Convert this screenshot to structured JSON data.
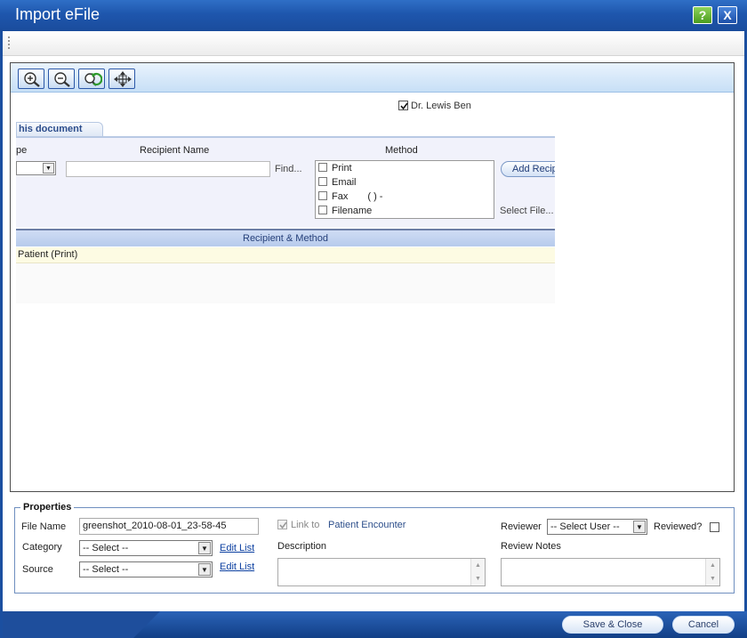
{
  "window": {
    "title": "Import eFile",
    "help_label": "?",
    "close_label": "X"
  },
  "viewer": {
    "tools": [
      "zoom-in-icon",
      "zoom-out-icon",
      "rotate-icon",
      "fit-icon"
    ],
    "doc": {
      "top_check_label": "Dr. Lewis Ben",
      "tab_label": "his document",
      "col_type": "pe",
      "col_recipient": "Recipient Name",
      "col_method": "Method",
      "find_label": "Find...",
      "methods": [
        "Print",
        "Email",
        "Fax",
        "Filename"
      ],
      "fax_number": "(   )   -",
      "add_recipient_label": "Add Recip",
      "select_file_label": "Select File...",
      "recipient_header": "Recipient & Method",
      "recipient_rows": [
        "Patient (Print)"
      ]
    }
  },
  "properties": {
    "legend": "Properties",
    "file_name_label": "File Name",
    "file_name_value": "greenshot_2010-08-01_23-58-45",
    "category_label": "Category",
    "category_value": "-- Select --",
    "source_label": "Source",
    "source_value": "-- Select --",
    "edit_list_label": "Edit List",
    "link_to_label": "Link to",
    "link_target": "Patient Encounter",
    "description_label": "Description",
    "reviewer_label": "Reviewer",
    "reviewer_value": "-- Select User --",
    "reviewed_label": "Reviewed?",
    "review_notes_label": "Review Notes"
  },
  "footer": {
    "save_label": "Save & Close",
    "cancel_label": "Cancel"
  }
}
